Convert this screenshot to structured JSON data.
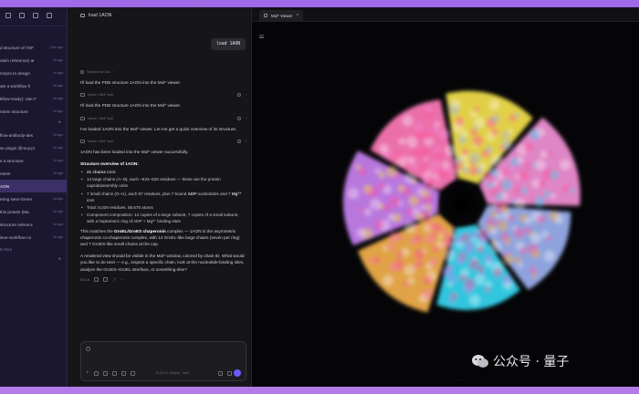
{
  "sidebar": {
    "items": [
      {
        "label": "d structure of TOF",
        "time": "24m ago"
      },
      {
        "label": "otein reference) at",
        "time": "1d ago"
      },
      {
        "label": "nmpro to design",
        "time": "1d ago"
      },
      {
        "label": "ate a workflow fr",
        "time": "1d ago"
      },
      {
        "label": "kflow-ready): Use F",
        "time": "1d ago"
      },
      {
        "label": "rotein structure",
        "time": "1d ago"
      },
      {
        "label": "",
        "time": ""
      },
      {
        "label": "flow-antibody-des",
        "time": "1d ago"
      },
      {
        "label": "se plugin @mcp:pr",
        "time": "1d ago"
      },
      {
        "label": "e a structure",
        "time": "1d ago"
      },
      {
        "label": "rotein",
        "time": "1d ago"
      },
      {
        "label": "AON",
        "time": ""
      },
      {
        "label": "ering Next-Gener",
        "time": "1d ago"
      },
      {
        "label": "this protein (Ma",
        "time": "1d ago"
      },
      {
        "label": "structure referenc",
        "time": "1d ago"
      },
      {
        "label": "isoe-workflow-co",
        "time": "1d ago"
      }
    ],
    "more_label": "5 more"
  },
  "chat": {
    "title": "load 1AON",
    "user_message": "load 1AON",
    "worked_label": "Worked for 10s",
    "tool_label": "Used 1 Mol* tool",
    "msg1": "I'll load the PDB structure 1AON into the Mol* viewer.",
    "msg2": "I'll load the PDB structure 1AON into the Mol* viewer.",
    "msg3": "I've loaded 1AON into the Mol* viewer. Let me get a quick overview of its structure.",
    "msg4": "1AON has been loaded into the Mol* viewer successfully.",
    "overview_heading": "Structure overview of 1AON:",
    "chains_bold": "21 chains",
    "chains_rest": " total:",
    "bullet_large": "14 large chains (A–N), each ~524–526 residues — these are the protein capsid/assembly units",
    "bullet_small_pre": "7 small chains (O–U), each 97 residues, plus 7 bound ",
    "bullet_small_adp": "ADP",
    "bullet_small_mid": " nucleotides and 7 ",
    "bullet_small_mg": "Mg²⁺",
    "bullet_small_post": " ions",
    "total_line": "Total: 8,029 residues, 58,670 atoms",
    "composition_line": "Component composition: 14 copies of a large subunit, 7 copies of a small subunit, with a heptameric ring of ADP + Mg²⁺ binding sites",
    "matches_pre": "This matches the ",
    "matches_bold": "GroEL/GroES chaperonin",
    "matches_post": " complex — 1AON is the asymmetric chaperonin co-chaperonin complex, with 14 GroEL-like large chains (seven per ring) and 7 GroES-like small chains at the cap.",
    "final_para": "A rendered view should be visible in the Mol* window, colored by chain ID. What would you like to do next — e.g., inspect a specific chain, look at the nucleotide-binding sites, analyze the GroES–GroEL interface, or something else?",
    "timestamp": "06:16",
    "composer_model": "GLM-5.1 (Zhipu) · auto"
  },
  "viewer": {
    "tab_label": "Mol* Viewer",
    "close_glyph": "×"
  },
  "watermark": {
    "text": "公众号 · 量子"
  },
  "colors": {
    "sidebar_bg": "#1c1730",
    "chat_bg": "#16161a",
    "viewer_bg": "#050507",
    "accent": "#6a5cff",
    "segments": [
      "#f3e14a",
      "#f28fd6",
      "#9ab0f0",
      "#35d7f0",
      "#f2b04a",
      "#c880f0",
      "#ff7ab8"
    ]
  }
}
